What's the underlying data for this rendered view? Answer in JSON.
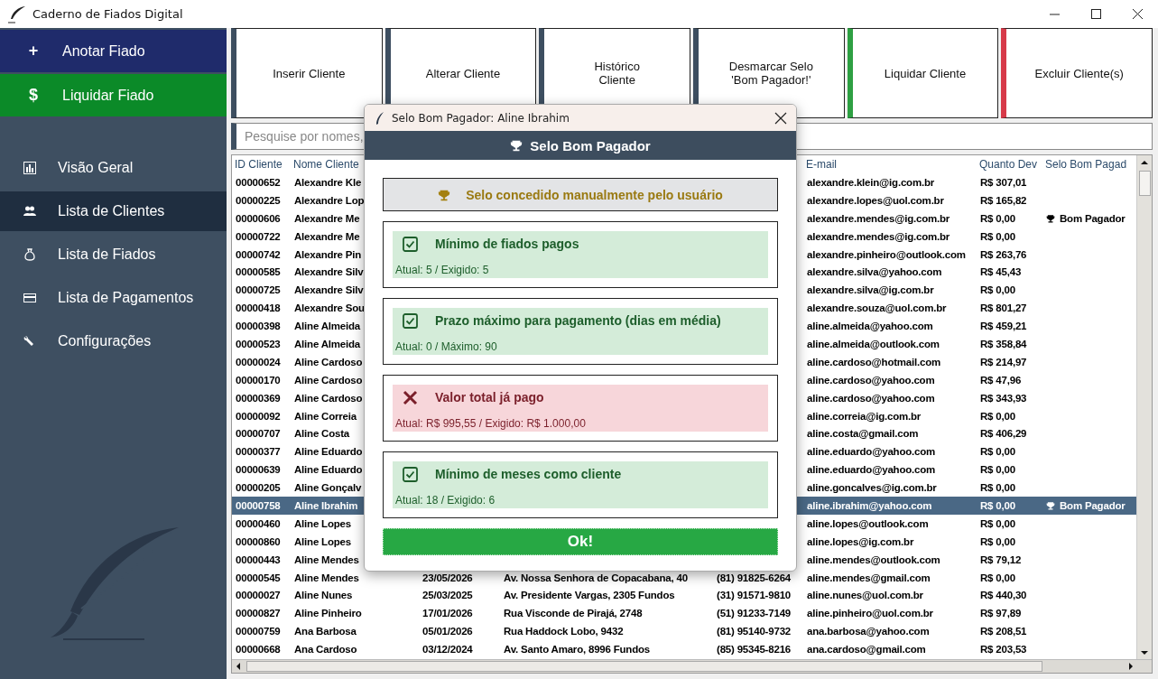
{
  "window": {
    "title": "Caderno de Fiados Digital"
  },
  "sidebar": {
    "actions": [
      {
        "icon": "+",
        "label": "Anotar Fiado",
        "color": "#1f2b6b"
      },
      {
        "icon": "$",
        "label": "Liquidar Fiado",
        "color": "#0b8a28"
      }
    ],
    "items": [
      {
        "label": "Visão Geral",
        "selected": false
      },
      {
        "label": "Lista de Clientes",
        "selected": true
      },
      {
        "label": "Lista de Fiados",
        "selected": false
      },
      {
        "label": "Lista de Pagamentos",
        "selected": false
      },
      {
        "label": "Configurações",
        "selected": false
      }
    ]
  },
  "toolbar": [
    {
      "label": "Inserir Cliente",
      "color": "#3d4e60"
    },
    {
      "label": "Alterar Cliente",
      "color": "#3d4e60"
    },
    {
      "label": "Histórico\nCliente",
      "color": "#3d4e60"
    },
    {
      "label": "Desmarcar Selo\n'Bom Pagador!'",
      "color": "#3d4e60"
    },
    {
      "label": "Liquidar Cliente",
      "color": "#2ea043"
    },
    {
      "label": "Excluir Cliente(s)",
      "color": "#d73a49"
    }
  ],
  "search": {
    "placeholder": "Pesquise por nomes,"
  },
  "table": {
    "columns": [
      "ID Cliente",
      "Nome Cliente",
      null,
      null,
      null,
      "E-mail",
      "Quanto Dev",
      "Selo Bom Pagad"
    ],
    "rows": [
      {
        "selected": false,
        "cells": [
          "00000652",
          "Alexandre Kle",
          null,
          null,
          null,
          "alexandre.klein@ig.com.br",
          "R$ 307,01",
          null
        ]
      },
      {
        "selected": false,
        "cells": [
          "00000225",
          "Alexandre Lop",
          null,
          null,
          null,
          "alexandre.lopes@uol.com.br",
          "R$ 165,82",
          null
        ]
      },
      {
        "selected": false,
        "cells": [
          "00000606",
          "Alexandre Me",
          null,
          null,
          null,
          "alexandre.mendes@ig.com.br",
          "R$ 0,00",
          "Bom Pagador"
        ]
      },
      {
        "selected": false,
        "cells": [
          "00000722",
          "Alexandre Me",
          null,
          null,
          null,
          "alexandre.mendes@ig.com.br",
          "R$ 0,00",
          null
        ]
      },
      {
        "selected": false,
        "cells": [
          "00000742",
          "Alexandre Pin",
          null,
          null,
          null,
          "alexandre.pinheiro@outlook.com",
          "R$ 263,76",
          null
        ]
      },
      {
        "selected": false,
        "cells": [
          "00000585",
          "Alexandre Silv",
          null,
          null,
          null,
          "alexandre.silva@yahoo.com",
          "R$ 45,43",
          null
        ]
      },
      {
        "selected": false,
        "cells": [
          "00000725",
          "Alexandre Silv",
          null,
          null,
          null,
          "alexandre.silva@ig.com.br",
          "R$ 0,00",
          null
        ]
      },
      {
        "selected": false,
        "cells": [
          "00000418",
          "Alexandre Sou",
          null,
          null,
          null,
          "alexandre.souza@uol.com.br",
          "R$ 801,27",
          null
        ]
      },
      {
        "selected": false,
        "cells": [
          "00000398",
          "Aline Almeida",
          null,
          null,
          null,
          "aline.almeida@yahoo.com",
          "R$ 459,21",
          null
        ]
      },
      {
        "selected": false,
        "cells": [
          "00000523",
          "Aline Almeida",
          null,
          null,
          null,
          "aline.almeida@outlook.com",
          "R$ 358,84",
          null
        ]
      },
      {
        "selected": false,
        "cells": [
          "00000024",
          "Aline Cardoso",
          null,
          null,
          null,
          "aline.cardoso@hotmail.com",
          "R$ 214,97",
          null
        ]
      },
      {
        "selected": false,
        "cells": [
          "00000170",
          "Aline Cardoso",
          null,
          null,
          null,
          "aline.cardoso@yahoo.com",
          "R$ 47,96",
          null
        ]
      },
      {
        "selected": false,
        "cells": [
          "00000369",
          "Aline Cardoso",
          null,
          null,
          null,
          "aline.cardoso@yahoo.com",
          "R$ 343,93",
          null
        ]
      },
      {
        "selected": false,
        "cells": [
          "00000092",
          "Aline Correia",
          null,
          null,
          null,
          "aline.correia@ig.com.br",
          "R$ 0,00",
          null
        ]
      },
      {
        "selected": false,
        "cells": [
          "00000707",
          "Aline Costa",
          null,
          null,
          null,
          "aline.costa@gmail.com",
          "R$ 406,29",
          null
        ]
      },
      {
        "selected": false,
        "cells": [
          "00000377",
          "Aline Eduardo",
          null,
          null,
          null,
          "aline.eduardo@yahoo.com",
          "R$ 0,00",
          null
        ]
      },
      {
        "selected": false,
        "cells": [
          "00000639",
          "Aline Eduardo",
          null,
          null,
          null,
          "aline.eduardo@yahoo.com",
          "R$ 0,00",
          null
        ]
      },
      {
        "selected": false,
        "cells": [
          "00000205",
          "Aline Gonçalv",
          null,
          null,
          null,
          "aline.goncalves@ig.com.br",
          "R$ 0,00",
          null
        ]
      },
      {
        "selected": true,
        "cells": [
          "00000758",
          "Aline Ibrahim",
          null,
          null,
          null,
          "aline.ibrahim@yahoo.com",
          "R$ 0,00",
          "Bom Pagador"
        ]
      },
      {
        "selected": false,
        "cells": [
          "00000460",
          "Aline Lopes",
          null,
          null,
          null,
          "aline.lopes@outlook.com",
          "R$ 0,00",
          null
        ]
      },
      {
        "selected": false,
        "cells": [
          "00000860",
          "Aline Lopes",
          null,
          null,
          null,
          "aline.lopes@ig.com.br",
          "R$ 0,00",
          null
        ]
      },
      {
        "selected": false,
        "cells": [
          "00000443",
          "Aline Mendes",
          null,
          null,
          null,
          "aline.mendes@outlook.com",
          "R$ 79,12",
          null
        ]
      },
      {
        "selected": false,
        "cells": [
          "00000545",
          "Aline Mendes",
          "23/05/2026",
          "Av. Nossa Senhora de Copacabana, 40",
          "(81) 91825-6264",
          "aline.mendes@gmail.com",
          "R$ 0,00",
          null
        ]
      },
      {
        "selected": false,
        "cells": [
          "00000027",
          "Aline Nunes",
          "25/03/2025",
          "Av. Presidente Vargas, 2305 Fundos",
          "(31) 91571-9810",
          "aline.nunes@uol.com.br",
          "R$ 440,30",
          null
        ]
      },
      {
        "selected": false,
        "cells": [
          "00000827",
          "Aline Pinheiro",
          "17/01/2026",
          "Rua Visconde de Pirajá, 2748",
          "(51) 91233-7149",
          "aline.pinheiro@uol.com.br",
          "R$ 97,89",
          null
        ]
      },
      {
        "selected": false,
        "cells": [
          "00000759",
          "Ana Barbosa",
          "05/01/2026",
          "Rua Haddock Lobo, 9432",
          "(81) 95140-9732",
          "ana.barbosa@yahoo.com",
          "R$ 208,51",
          null
        ]
      },
      {
        "selected": false,
        "cells": [
          "00000668",
          "Ana Cardoso",
          "03/12/2024",
          "Av. Santo Amaro, 8996 Fundos",
          "(85) 95345-8216",
          "ana.cardoso@gmail.com",
          "R$ 203,53",
          null
        ]
      }
    ]
  },
  "dialog": {
    "title": "Selo Bom Pagador: Aline Ibrahim",
    "heading": "Selo Bom Pagador",
    "notice": "Selo concedido manualmente pelo usuário",
    "criteria": [
      {
        "met": true,
        "title": "Mínimo de fiados pagos",
        "detail": "Atual: 5 / Exigido: 5"
      },
      {
        "met": true,
        "title": "Prazo máximo para pagamento (dias em média)",
        "detail": "Atual: 0 / Máximo: 90"
      },
      {
        "met": false,
        "title": "Valor total já pago",
        "detail": "Atual: R$ 995,55 / Exigido: R$ 1.000,00"
      },
      {
        "met": true,
        "title": "Mínimo de meses como cliente",
        "detail": "Atual: 18 / Exigido: 6"
      }
    ],
    "ok_button": "Ok!"
  }
}
